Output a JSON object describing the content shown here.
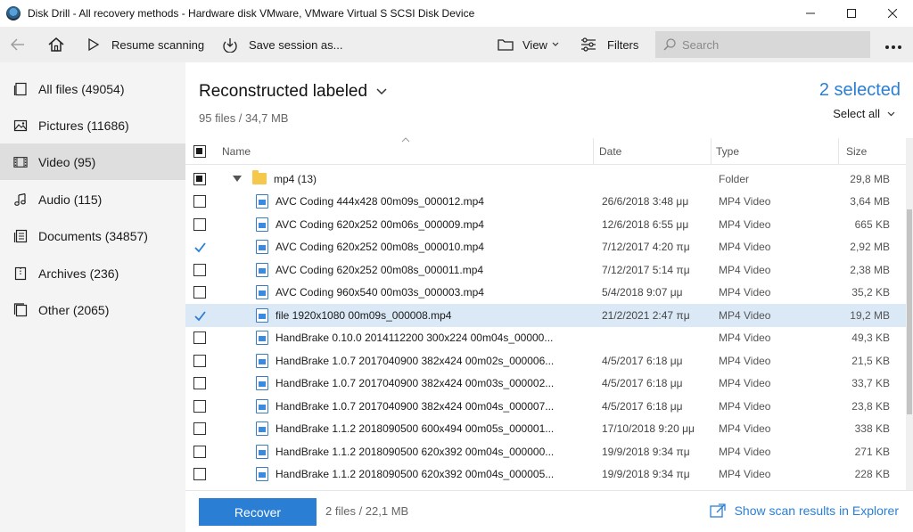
{
  "window": {
    "title": "Disk Drill - All recovery methods - Hardware disk VMware, VMware Virtual S SCSI Disk Device"
  },
  "toolbar": {
    "resume_label": "Resume scanning",
    "save_label": "Save session as...",
    "view_label": "View",
    "filters_label": "Filters",
    "search_placeholder": "Search"
  },
  "sidebar": {
    "items": [
      {
        "label": "All files (49054)",
        "icon": "all-files-icon"
      },
      {
        "label": "Pictures (11686)",
        "icon": "pictures-icon"
      },
      {
        "label": "Video (95)",
        "icon": "video-icon",
        "active": true
      },
      {
        "label": "Audio (115)",
        "icon": "audio-icon"
      },
      {
        "label": "Documents (34857)",
        "icon": "documents-icon"
      },
      {
        "label": "Archives (236)",
        "icon": "archives-icon"
      },
      {
        "label": "Other (2065)",
        "icon": "other-icon"
      }
    ]
  },
  "main": {
    "title": "Reconstructed labeled",
    "subtitle": "95 files / 34,7 MB",
    "selected_count": "2 selected",
    "select_all": "Select all"
  },
  "table": {
    "columns": {
      "name": "Name",
      "date": "Date",
      "type": "Type",
      "size": "Size"
    },
    "folder": {
      "name": "mp4 (13)",
      "type": "Folder",
      "size": "29,8 MB"
    },
    "rows": [
      {
        "name": "AVC Coding 444x428 00m09s_000012.mp4",
        "date": "26/6/2018 3:48 μμ",
        "type": "MP4 Video",
        "size": "3,64 MB",
        "checked": false
      },
      {
        "name": "AVC Coding 620x252 00m06s_000009.mp4",
        "date": "12/6/2018 6:55 μμ",
        "type": "MP4 Video",
        "size": "665 KB",
        "checked": false
      },
      {
        "name": "AVC Coding 620x252 00m08s_000010.mp4",
        "date": "7/12/2017 4:20 πμ",
        "type": "MP4 Video",
        "size": "2,92 MB",
        "checked": true
      },
      {
        "name": "AVC Coding 620x252 00m08s_000011.mp4",
        "date": "7/12/2017 5:14 πμ",
        "type": "MP4 Video",
        "size": "2,38 MB",
        "checked": false
      },
      {
        "name": "AVC Coding 960x540 00m03s_000003.mp4",
        "date": "5/4/2018 9:07 μμ",
        "type": "MP4 Video",
        "size": "35,2 KB",
        "checked": false
      },
      {
        "name": "file 1920x1080 00m09s_000008.mp4",
        "date": "21/2/2021 2:47 πμ",
        "type": "MP4 Video",
        "size": "19,2 MB",
        "checked": true,
        "highlight": true
      },
      {
        "name": "HandBrake 0.10.0 2014112200 300x224 00m04s_00000...",
        "date": "",
        "type": "MP4 Video",
        "size": "49,3 KB",
        "checked": false
      },
      {
        "name": "HandBrake 1.0.7 2017040900 382x424 00m02s_000006...",
        "date": "4/5/2017 6:18 μμ",
        "type": "MP4 Video",
        "size": "21,5 KB",
        "checked": false
      },
      {
        "name": "HandBrake 1.0.7 2017040900 382x424 00m03s_000002...",
        "date": "4/5/2017 6:18 μμ",
        "type": "MP4 Video",
        "size": "33,7 KB",
        "checked": false
      },
      {
        "name": "HandBrake 1.0.7 2017040900 382x424 00m04s_000007...",
        "date": "4/5/2017 6:18 μμ",
        "type": "MP4 Video",
        "size": "23,8 KB",
        "checked": false
      },
      {
        "name": "HandBrake 1.1.2 2018090500 600x494 00m05s_000001...",
        "date": "17/10/2018 9:20 μμ",
        "type": "MP4 Video",
        "size": "338 KB",
        "checked": false
      },
      {
        "name": "HandBrake 1.1.2 2018090500 620x392 00m04s_000000...",
        "date": "19/9/2018 9:34 πμ",
        "type": "MP4 Video",
        "size": "271 KB",
        "checked": false
      },
      {
        "name": "HandBrake 1.1.2 2018090500 620x392 00m04s_000005...",
        "date": "19/9/2018 9:34 πμ",
        "type": "MP4 Video",
        "size": "228 KB",
        "checked": false
      }
    ]
  },
  "bottom": {
    "recover_label": "Recover",
    "recover_info": "2 files / 22,1 MB",
    "explorer_label": "Show scan results in Explorer"
  },
  "colors": {
    "accent": "#2a7fd4",
    "selected_row": "#dbe9f7",
    "sidebar_bg": "#f4f4f4",
    "toolbar_bg": "#eeeeee"
  }
}
